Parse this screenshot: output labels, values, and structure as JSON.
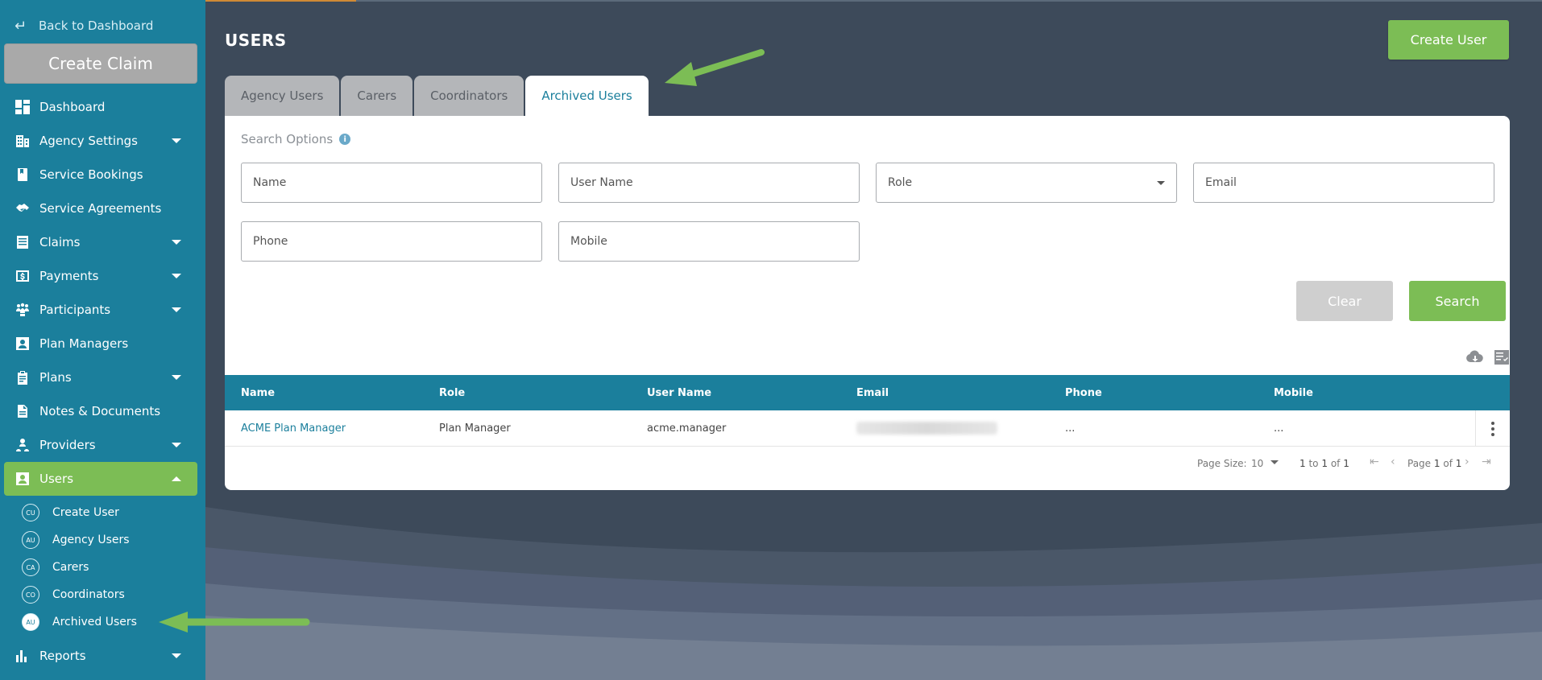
{
  "sidebar": {
    "back_label": "Back to Dashboard",
    "create_claim_label": "Create Claim",
    "items": [
      {
        "label": "Dashboard"
      },
      {
        "label": "Agency Settings"
      },
      {
        "label": "Service Bookings"
      },
      {
        "label": "Service Agreements"
      },
      {
        "label": "Claims"
      },
      {
        "label": "Payments"
      },
      {
        "label": "Participants"
      },
      {
        "label": "Plan Managers"
      },
      {
        "label": "Plans"
      },
      {
        "label": "Notes & Documents"
      },
      {
        "label": "Providers"
      },
      {
        "label": "Users"
      },
      {
        "label": "Reports"
      }
    ],
    "users_sub": [
      {
        "badge": "CU",
        "label": "Create User"
      },
      {
        "badge": "AU",
        "label": "Agency Users"
      },
      {
        "badge": "CA",
        "label": "Carers"
      },
      {
        "badge": "CO",
        "label": "Coordinators"
      },
      {
        "badge": "AU",
        "label": "Archived Users"
      }
    ]
  },
  "header": {
    "title": "USERS",
    "create_user_label": "Create User"
  },
  "tabs": [
    {
      "label": "Agency Users"
    },
    {
      "label": "Carers"
    },
    {
      "label": "Coordinators"
    },
    {
      "label": "Archived Users"
    }
  ],
  "search": {
    "label": "Search Options",
    "fields": {
      "name": "Name",
      "username": "User Name",
      "role": "Role",
      "email": "Email",
      "phone": "Phone",
      "mobile": "Mobile"
    },
    "clear_label": "Clear",
    "search_label": "Search"
  },
  "table": {
    "columns": [
      "Name",
      "Role",
      "User Name",
      "Email",
      "Phone",
      "Mobile"
    ],
    "rows": [
      {
        "name": "ACME Plan Manager",
        "role": "Plan Manager",
        "username": "acme.manager",
        "phone": "...",
        "mobile": "..."
      }
    ]
  },
  "pager": {
    "page_size_label": "Page Size:",
    "page_size": "10",
    "from": "1",
    "to_label": "to",
    "to": "1",
    "of_label": "of",
    "total": "1",
    "page_label": "Page",
    "page": "1",
    "pages": "1"
  },
  "colors": {
    "sidebar": "#1b7f9c",
    "accent_green": "#7cbd55",
    "background": "#3d4a5a"
  }
}
